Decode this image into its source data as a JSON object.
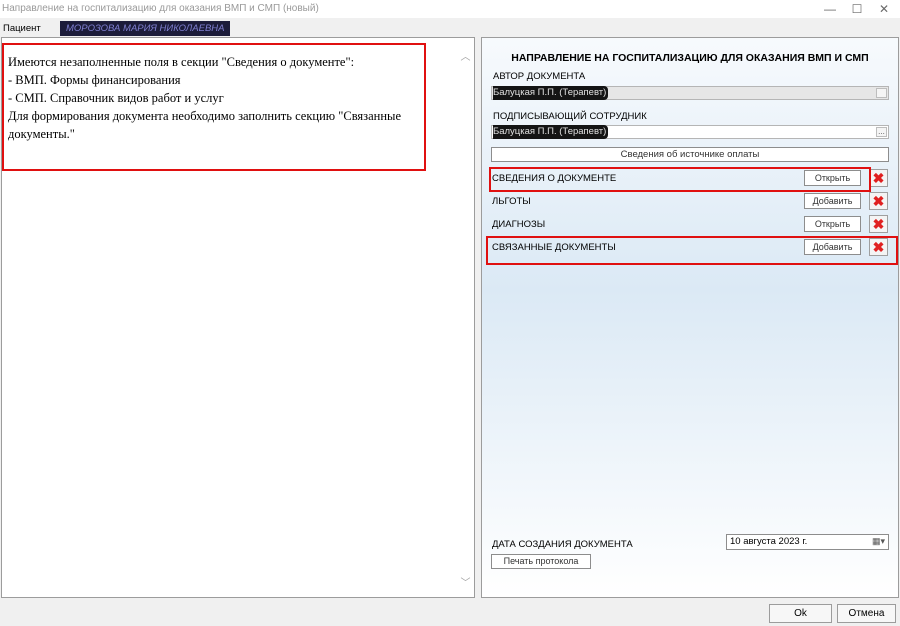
{
  "window": {
    "title": "Направление на госпитализацию для оказания ВМП и СМП (новый)",
    "minimize_icon": "—",
    "maximize_icon": "☐",
    "close_icon": "✕"
  },
  "patient": {
    "label": "Пациент",
    "name": "МОРОЗОВА МАРИЯ НИКОЛАЕВНА"
  },
  "messages": {
    "lines": [
      "Имеются незаполненные поля в секции \"Сведения о документе\":",
      "- ВМП. Формы финансирования",
      "- СМП. Справочник видов работ и услуг",
      "Для формирования документа необходимо заполнить секцию \"Связанные документы.\""
    ]
  },
  "form": {
    "title": "НАПРАВЛЕНИЕ НА ГОСПИТАЛИЗАЦИЮ ДЛЯ ОКАЗАНИЯ ВМП И СМП",
    "author_label": "АВТОР ДОКУМЕНТА",
    "author_value": "Балуцкая П.П. (Терапевт)",
    "signer_label": "ПОДПИСЫВАЮЩИЙ СОТРУДНИК",
    "signer_value": "Балуцкая П.П. (Терапевт)",
    "lookup_button": "...",
    "payment_button": "Сведения об источнике оплаты",
    "sections": [
      {
        "label": "СВЕДЕНИЯ О ДОКУМЕНТЕ",
        "button": "Открыть"
      },
      {
        "label": "ЛЬГОТЫ",
        "button": "Добавить"
      },
      {
        "label": "ДИАГНОЗЫ",
        "button": "Открыть"
      },
      {
        "label": "СВЯЗАННЫЕ ДОКУМЕНТЫ",
        "button": "Добавить"
      }
    ],
    "delete_icon": "✖",
    "date_label": "ДАТА СОЗДАНИЯ ДОКУМЕНТА",
    "date_value": "10 августа  2023 г.",
    "calendar_icon": "▦▾",
    "print_button": "Печать протокола"
  },
  "footer": {
    "ok": "Ok",
    "cancel": "Отмена"
  },
  "colors": {
    "highlight": "#e01010",
    "delete": "#e02020"
  }
}
